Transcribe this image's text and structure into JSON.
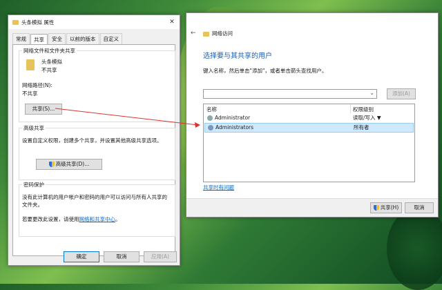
{
  "props": {
    "title": "头条模拟 属性",
    "tabs": [
      "常规",
      "共享",
      "安全",
      "以前的版本",
      "自定义"
    ],
    "group1_title": "网络文件和文件夹共享",
    "folder_name": "头条模拟",
    "share_state": "不共享",
    "path_label": "网络路径(N):",
    "path_value": "不共享",
    "share_button": "共享(S)...",
    "group2_title": "高级共享",
    "adv_desc": "设置自定义权限，创建多个共享，并设置其他高级共享选项。",
    "adv_button": "高级共享(D)...",
    "group3_title": "密码保护",
    "pw_desc": "没有此计算机的用户帐户和密码的用户可以访问与所有人共享的文件夹。",
    "pw_change_prefix": "若要更改此设置，请使用",
    "pw_link": "网络和共享中心",
    "pw_suffix": "。",
    "ok": "确定",
    "cancel": "取消",
    "apply": "应用(A)"
  },
  "share": {
    "title": "网络访问",
    "heading": "选择要与其共享的用户",
    "instruction": "键入名称，然后单击\"添加\"，或者单击箭头查找用户。",
    "add_button": "添加(A)",
    "col_name": "名称",
    "col_perm": "权限级别",
    "rows": [
      {
        "name": "Administrator",
        "perm": "读取/写入 ▼"
      },
      {
        "name": "Administrators",
        "perm": "所有者"
      }
    ],
    "trouble_link": "共享时有问题",
    "share_button": "共享(H)",
    "cancel_button": "取消"
  },
  "colors": {
    "accent": "#0078d7",
    "link": "#0066cc",
    "arrow": "#e03030"
  }
}
